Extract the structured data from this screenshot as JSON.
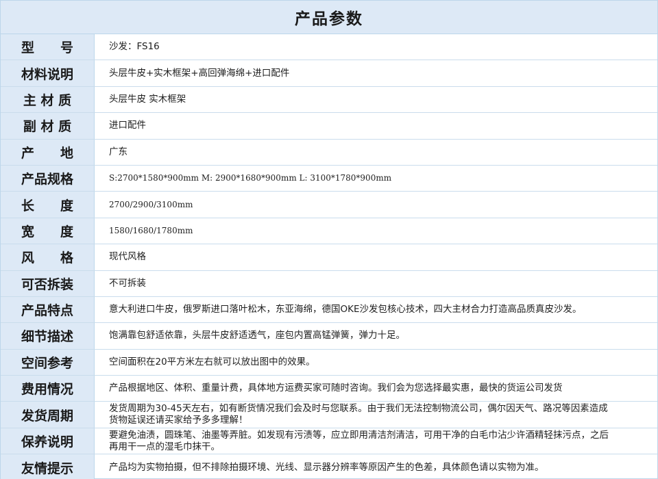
{
  "title": "产品参数",
  "rows": [
    {
      "label": "型　　号",
      "value": "沙发：FS16"
    },
    {
      "label": "材料说明",
      "value": "头层牛皮+实木框架+高回弹海绵+进口配件"
    },
    {
      "label": "主 材 质",
      "value": "头层牛皮 实木框架"
    },
    {
      "label": "副 材 质",
      "value": "进口配件"
    },
    {
      "label": "产　　地",
      "value": "广东"
    },
    {
      "label": "产品规格",
      "value": "S:2700*1580*900mm  M: 2900*1680*900mm  L: 3100*1780*900mm"
    },
    {
      "label": "长　　度",
      "value": "2700/2900/3100mm"
    },
    {
      "label": "宽　　度",
      "value": "1580/1680/1780mm"
    },
    {
      "label": "风　　格",
      "value": "现代风格"
    },
    {
      "label": "可否拆装",
      "value": "不可拆装"
    },
    {
      "label": "产品特点",
      "value": "意大利进口牛皮，俄罗斯进口落叶松木，东亚海绵，德国OKE沙发包核心技术，四大主材合力打造高品质真皮沙发。"
    },
    {
      "label": "细节描述",
      "value": "饱满靠包舒适依靠，头层牛皮舒适透气，座包内置高锰弹簧，弹力十足。"
    },
    {
      "label": "空间参考",
      "value": "空间面积在20平方米左右就可以放出图中的效果。"
    },
    {
      "label": "费用情况",
      "value": "产品根据地区、体积、重量计费，具体地方运费买家可随时咨询。我们会为您选择最实惠，最快的货运公司发货"
    },
    {
      "label": "发货周期",
      "value": "发货周期为30-45天左右，如有断货情况我们会及时与您联系。由于我们无法控制物流公司，偶尔因天气、路况等因素造成货物延误还请买家给予多多理解！"
    },
    {
      "label": "保养说明",
      "value": "要避免油渍，圆珠笔、油墨等弄脏。如发现有污渍等，应立即用清洁剂清洁，可用干净的白毛巾沾少许酒精轻抹污点，之后再用干一点的湿毛巾抹干。"
    },
    {
      "label": "友情提示",
      "value": "产品均为实物拍摄，但不排除拍摄环境、光线、显示器分辨率等原因产生的色差，具体颜色请以实物为准。"
    }
  ]
}
